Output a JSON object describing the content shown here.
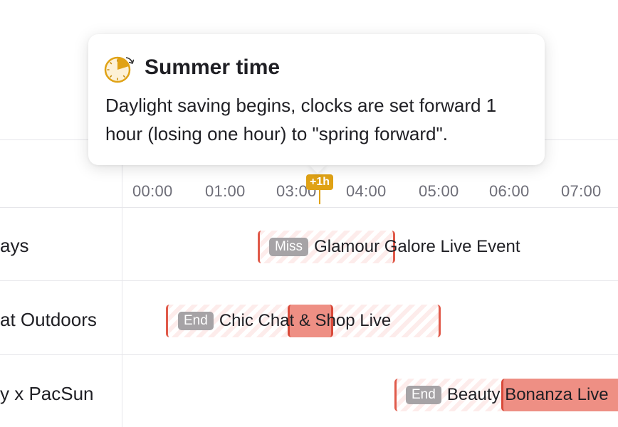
{
  "colors": {
    "dst_badge": "#e0a215",
    "event_accent": "#e05a4a",
    "status_badge": "#a6a3a6"
  },
  "tooltip": {
    "icon": "clock-forward-icon",
    "title": "Summer time",
    "body": "Daylight saving begins, clocks are set forward 1 hour (losing one hour) to \"spring forward\"."
  },
  "timeline": {
    "ticks": [
      "00:00",
      "01:00",
      "03:00",
      "04:00",
      "05:00",
      "06:00",
      "07:00"
    ],
    "dst_badge": "+1h"
  },
  "rows": [
    {
      "label": "ays",
      "events": [
        {
          "status": "Miss",
          "title": "Glamour Galore Live Event"
        }
      ]
    },
    {
      "label": "at Outdoors",
      "events": [
        {
          "status": "End",
          "title": "Chic Chat & Shop Live"
        }
      ]
    },
    {
      "label": "y x PacSun",
      "events": [
        {
          "status": "End",
          "title": "Beauty Bonanza Live"
        }
      ]
    }
  ]
}
